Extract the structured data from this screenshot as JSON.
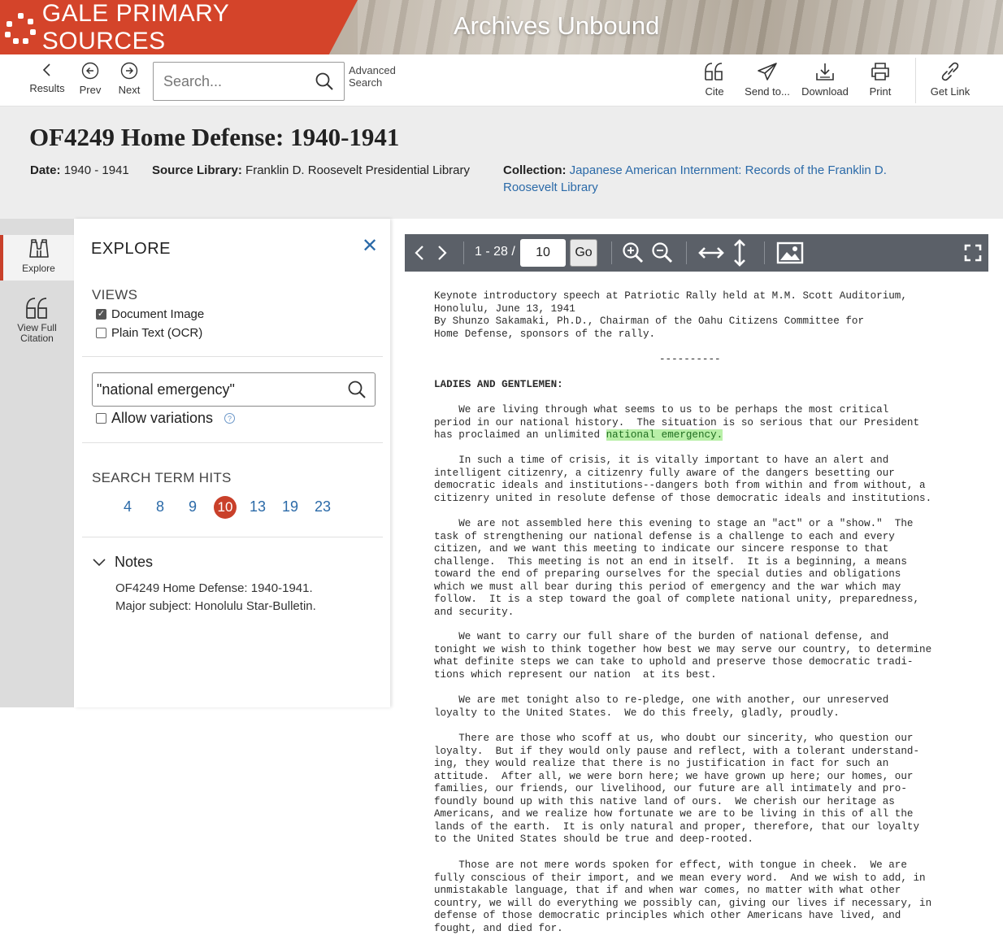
{
  "banner": {
    "brand": "GALE PRIMARY SOURCES",
    "archive": "Archives Unbound",
    "brand_color": "#d4442a"
  },
  "toolbar": {
    "results": "Results",
    "prev": "Prev",
    "next": "Next",
    "search_placeholder": "Search...",
    "advanced_line1": "Advanced",
    "advanced_line2": "Search",
    "cite": "Cite",
    "send_to": "Send to...",
    "download": "Download",
    "print": "Print",
    "get_link": "Get Link"
  },
  "document": {
    "title": "OF4249 Home Defense: 1940-1941",
    "date_label": "Date:",
    "date_value": "1940 - 1941",
    "source_label": "Source Library:",
    "source_value": "Franklin D. Roosevelt Presidential Library",
    "collection_label": "Collection:",
    "collection_line1": "Japanese American Internment: Records of the Franklin D.",
    "collection_line2": "Roosevelt Library"
  },
  "rail": {
    "explore": "Explore",
    "citation_line1": "View Full",
    "citation_line2": "Citation",
    "accent": "#c9402a"
  },
  "explore": {
    "title": "EXPLORE",
    "views_label": "VIEWS",
    "view_document": "Document Image",
    "view_document_checked": true,
    "view_ocr": "Plain Text (OCR)",
    "view_ocr_checked": false,
    "search_term": "\"national emergency\"",
    "allow_variations": "Allow variations",
    "hits_label": "SEARCH TERM HITS",
    "hits": [
      "4",
      "8",
      "9",
      "10",
      "13",
      "19",
      "23"
    ],
    "current_hit": "10",
    "notes_label": "Notes",
    "notes_line1": "OF4249 Home Defense: 1940-1941.",
    "notes_line2": "Major subject: Honolulu Star-Bulletin."
  },
  "viewer": {
    "page_range": "1 - 28 /",
    "page_input": "10",
    "go_label": "Go",
    "bar_color": "#5b6068"
  },
  "page_text": {
    "header_lines": [
      "Keynote introductory speech at Patriotic Rally held at M.M. Scott Auditorium,",
      "Honolulu, June 13, 1941",
      "By Shunzo Sakamaki, Ph.D., Chairman of the Oahu Citizens Committee for",
      "Home Defense, sponsors of the rally."
    ],
    "rule": "----------",
    "salutation": "LADIES AND GENTLEMEN:",
    "p1_lines": [
      "    We are living through what seems to us to be perhaps the most critical",
      "period in our national history.  The situation is so serious that our President",
      "has proclaimed an unlimited "
    ],
    "p1_highlight": "national emergency.",
    "p2_lines": [
      "    In such a time of crisis, it is vitally important to have an alert and",
      "intelligent citizenry, a citizenry fully aware of the dangers besetting our",
      "democratic ideals and institutions--dangers both from within and from without, a",
      "citizenry united in resolute defense of those democratic ideals and institutions."
    ],
    "p3_lines": [
      "    We are not assembled here this evening to stage an \"act\" or a \"show.\"  The",
      "task of strengthening our national defense is a challenge to each and every",
      "citizen, and we want this meeting to indicate our sincere response to that",
      "challenge.  This meeting is not an end in itself.  It is a beginning, a means",
      "toward the end of preparing ourselves for the special duties and obligations",
      "which we must all bear during this period of emergency and the war which may",
      "follow.  It is a step toward the goal of complete national unity, preparedness,",
      "and security."
    ],
    "p4_lines": [
      "    We want to carry our full share of the burden of national defense, and",
      "tonight we wish to think together how best we may serve our country, to determine",
      "what definite steps we can take to uphold and preserve those democratic tradi-",
      "tions which represent our nation  at its best."
    ],
    "p5_lines": [
      "    We are met tonight also to re-pledge, one with another, our unreserved",
      "loyalty to the United States.  We do this freely, gladly, proudly."
    ],
    "p6_lines": [
      "    There are those who scoff at us, who doubt our sincerity, who question our",
      "loyalty.  But if they would only pause and reflect, with a tolerant understand-",
      "ing, they would realize that there is no justification in fact for such an",
      "attitude.  After all, we were born here; we have grown up here; our homes, our",
      "families, our friends, our livelihood, our future are all intimately and pro-",
      "foundly bound up with this native land of ours.  We cherish our heritage as",
      "Americans, and we realize how fortunate we are to be living in this of all the",
      "lands of the earth.  It is only natural and proper, therefore, that our loyalty",
      "to the United States should be true and deep-rooted."
    ],
    "p7_lines": [
      "    Those are not mere words spoken for effect, with tongue in cheek.  We are",
      "fully conscious of their import, and we mean every word.  And we wish to add, in",
      "unmistakable language, that if and when war comes, no matter with what other",
      "country, we will do everything we possibly can, giving our lives if necessary, in",
      "defense of those democratic principles which other Americans have lived, and",
      "fought, and died for."
    ]
  }
}
